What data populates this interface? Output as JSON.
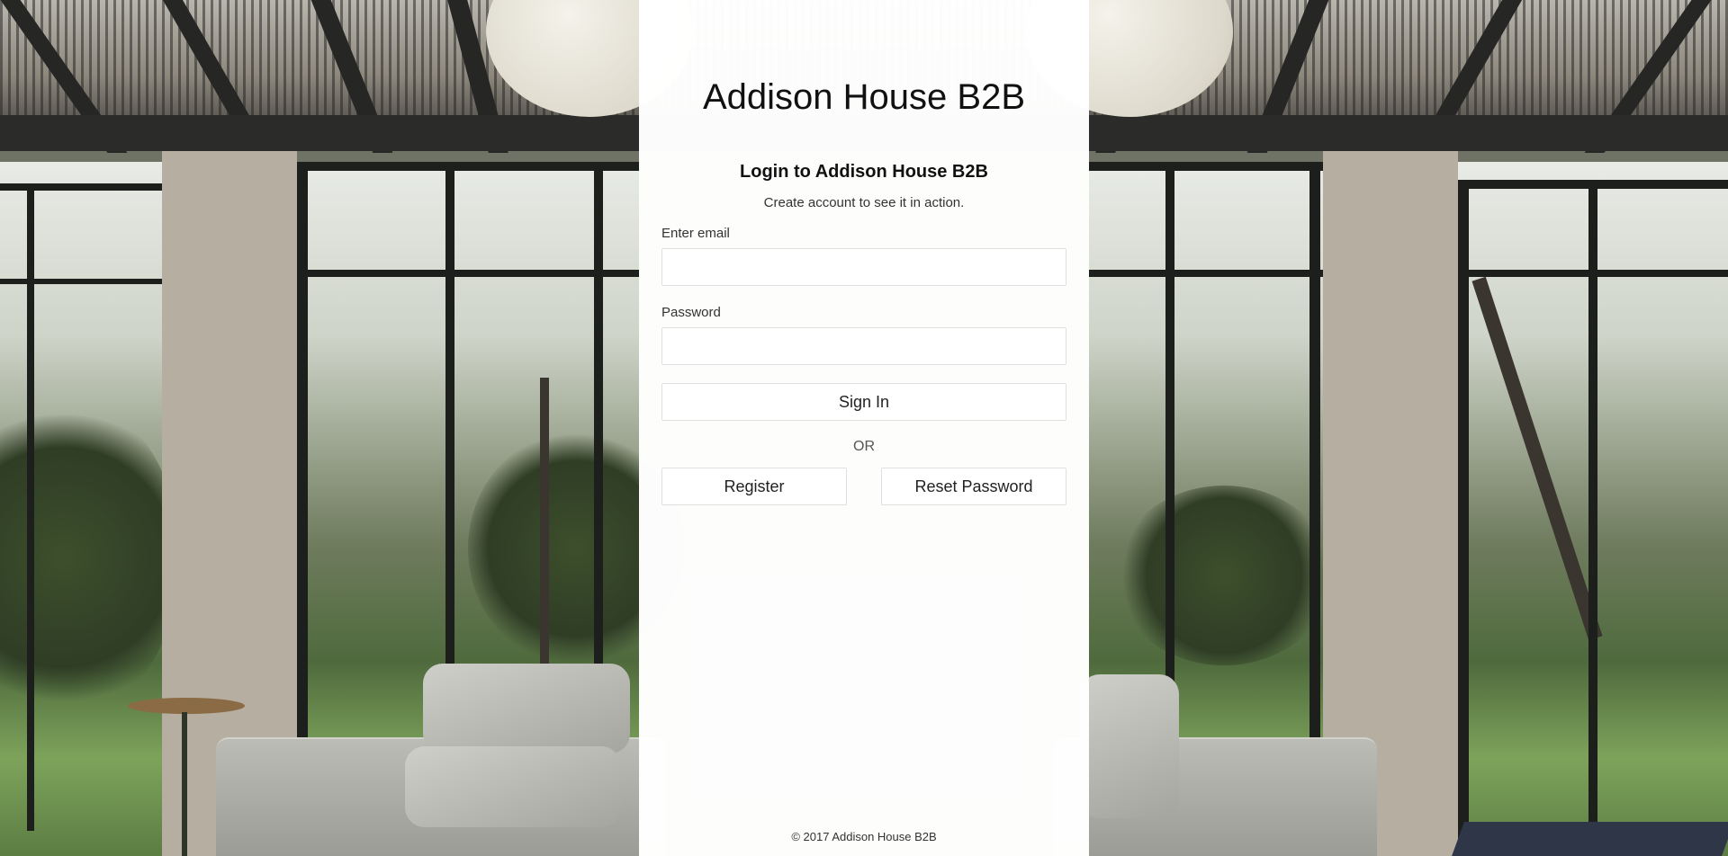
{
  "brand": {
    "title": "Addison House B2B"
  },
  "login": {
    "heading": "Login to Addison House B2B",
    "subheading": "Create account to see it in action.",
    "email_label": "Enter email",
    "email_value": "",
    "password_label": "Password",
    "password_value": "",
    "sign_in_label": "Sign In",
    "or_text": "OR",
    "register_label": "Register",
    "reset_label": "Reset Password"
  },
  "footer": {
    "copyright": "© 2017 Addison House B2B"
  },
  "colors": {
    "panel_background": "#ffffff",
    "text_primary": "#111111",
    "border": "#e0e0e0"
  }
}
